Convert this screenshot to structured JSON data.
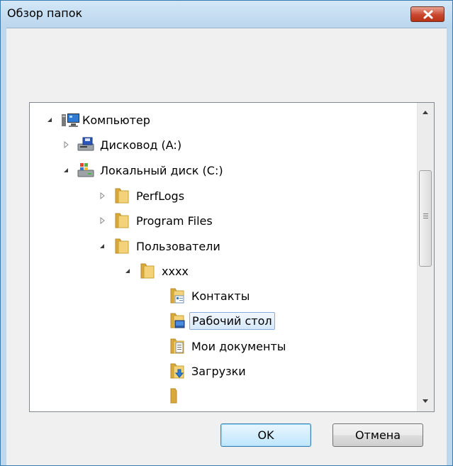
{
  "window": {
    "title": "Обзор папок",
    "close_icon": "close-icon"
  },
  "tree": {
    "items": [
      {
        "label": "Компьютер",
        "icon": "computer-icon",
        "toggle": "expanded"
      },
      {
        "label": "Дисковод (A:)",
        "icon": "floppy-drive-icon",
        "toggle": "collapsed"
      },
      {
        "label": "Локальный диск (C:)",
        "icon": "local-disk-icon",
        "toggle": "expanded"
      },
      {
        "label": "PerfLogs",
        "icon": "folder-icon",
        "toggle": "collapsed"
      },
      {
        "label": "Program Files",
        "icon": "folder-icon",
        "toggle": "collapsed"
      },
      {
        "label": "Пользователи",
        "icon": "folder-icon",
        "toggle": "expanded"
      },
      {
        "label": "xxxx",
        "icon": "folder-icon",
        "toggle": "expanded"
      },
      {
        "label": "Контакты",
        "icon": "contacts-folder-icon",
        "toggle": "none"
      },
      {
        "label": "Рабочий стол",
        "icon": "desktop-folder-icon",
        "toggle": "none",
        "selected": true
      },
      {
        "label": "Мои документы",
        "icon": "documents-folder-icon",
        "toggle": "none"
      },
      {
        "label": "Загрузки",
        "icon": "downloads-folder-icon",
        "toggle": "none"
      }
    ]
  },
  "buttons": {
    "ok": "OK",
    "cancel": "Отмена"
  },
  "colors": {
    "title_bar": "#bcd8ee",
    "close_button": "#c9472e",
    "selection": "#d5e8fa",
    "folder": "#e9c25a"
  }
}
